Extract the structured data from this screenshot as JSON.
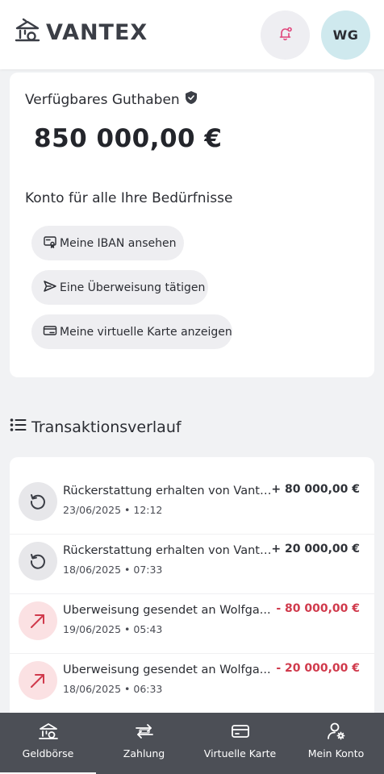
{
  "header": {
    "brand": "VANTEX",
    "avatar_initials": "WG"
  },
  "balance": {
    "label": "Verfügbares Guthaben",
    "amount": "850 000,00 €"
  },
  "account": {
    "subtitle": "Konto für alle Ihre Bedürfnisse",
    "actions": [
      {
        "label": "Meine IBAN ansehen",
        "icon": "iban-card-icon"
      },
      {
        "label": "Eine Überweisung tätigen",
        "icon": "send-icon"
      },
      {
        "label": "Meine virtuelle Karte anzeigen",
        "icon": "virtual-card-icon"
      }
    ]
  },
  "history": {
    "title": "Transaktionsverlauf",
    "transactions": [
      {
        "type": "refund",
        "title": "Rückerstattung erhalten von Vantex...",
        "date": "23/06/2025 • 12:12",
        "amount": "+ 80 000,00 €"
      },
      {
        "type": "refund",
        "title": "Rückerstattung erhalten von Vantex...",
        "date": "18/06/2025 • 07:33",
        "amount": "+ 20 000,00 €"
      },
      {
        "type": "sent",
        "title": "Überweisung gesendet an Wolfga...",
        "date": "19/06/2025 • 05:43",
        "amount": "- 80 000,00 €"
      },
      {
        "type": "sent",
        "title": "Überweisung gesendet an Wolfga...",
        "date": "18/06/2025 • 06:33",
        "amount": "- 20 000,00 €"
      }
    ]
  },
  "nav": {
    "items": [
      {
        "label": "Geldbörse",
        "icon": "wallet-bank-icon",
        "active": true
      },
      {
        "label": "Zahlung",
        "icon": "payment-exchange-icon"
      },
      {
        "label": "Virtuelle Karte",
        "icon": "card-icon"
      },
      {
        "label": "Mein Konto",
        "icon": "user-settings-icon"
      }
    ]
  },
  "colors": {
    "accent_negative": "#d03a4c",
    "bell_accent": "#e0457b",
    "nav_background": "#4c4f56",
    "avatar_background": "#cfe9ee"
  }
}
